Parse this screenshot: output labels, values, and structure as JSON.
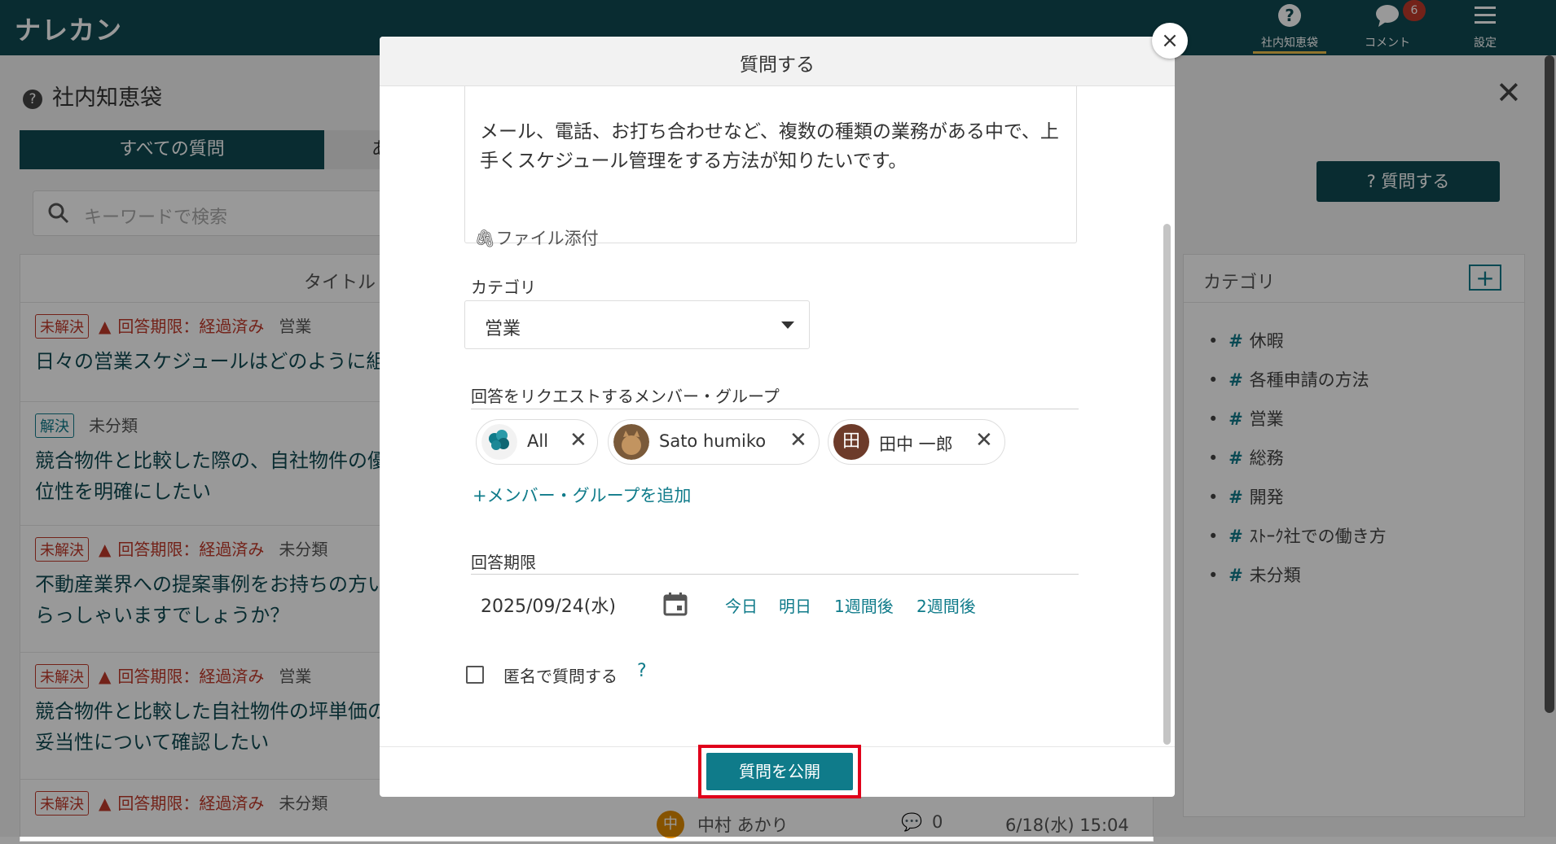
{
  "app": {
    "logo": "ナレカン"
  },
  "topnav": [
    {
      "label": "社内知恵袋",
      "icon": "question-circle-icon",
      "active": true
    },
    {
      "label": "コメント",
      "icon": "comment-bubble-icon",
      "badge": "6"
    },
    {
      "label": "設定",
      "icon": "hamburger-menu-icon"
    }
  ],
  "panel": {
    "title": "社内知恵袋",
    "tabs": [
      "すべての質問",
      "あ"
    ],
    "search_placeholder": "キーワードで検索",
    "column_title": "タイトル",
    "ask_button": "? 質問する"
  },
  "questions": [
    {
      "status": "未解決",
      "deadline": "回答期限：経過済み",
      "category": "営業",
      "title": "日々の営業スケジュールはどのように組"
    },
    {
      "status": "解決",
      "deadline": "",
      "category": "未分類",
      "title": "競合物件と比較した際の、自社物件の優位性を明確にしたい"
    },
    {
      "status": "未解決",
      "deadline": "回答期限：経過済み",
      "category": "未分類",
      "title": "不動産業界への提案事例をお持ちの方いらっしゃいますでしょうか？"
    },
    {
      "status": "未解決",
      "deadline": "回答期限：経過済み",
      "category": "営業",
      "title": "競合物件と比較した自社物件の坪単価の妥当性について確認したい"
    },
    {
      "status": "未解決",
      "deadline": "回答期限：経過済み",
      "category": "未分類",
      "title": ""
    }
  ],
  "last_row_info": {
    "avatar": "中",
    "author": "中村 あかり",
    "comments": "0",
    "date": "6/18(水) 15:04"
  },
  "categories": {
    "header": "カテゴリ",
    "add": "+",
    "items": [
      "休暇",
      "各種申請の方法",
      "営業",
      "総務",
      "開発",
      "ｽﾄｰｸ社での働き方",
      "未分類"
    ]
  },
  "modal": {
    "title": "質問する",
    "close": "×",
    "body_text": "メール、電話、お打ち合わせなど、複数の種類の業務がある中で、上手くスケジュール管理をする方法が知りたいです。",
    "attach_label": "ファイル添付",
    "category_label": "カテゴリ",
    "category_value": "営業",
    "request_label": "回答をリクエストするメンバー・グループ",
    "members": [
      "All",
      "Sato humiko",
      "田中 一郎"
    ],
    "member3_avatar": "田",
    "add_member": "+メンバー・グループを追加",
    "deadline_label": "回答期限",
    "deadline_value": "2025/09/24(水)",
    "quick_dates": [
      "今日",
      "明日",
      "1週間後",
      "2週間後"
    ],
    "anonymous_label": "匿名で質問する",
    "anonymous_help": "?",
    "anonymous_checked": false,
    "publish_button": "質問を公開"
  },
  "colors": {
    "brand": "#0f4a52",
    "accent": "#0f7b8a",
    "danger": "#c0392b",
    "highlight": "#e0001b"
  }
}
